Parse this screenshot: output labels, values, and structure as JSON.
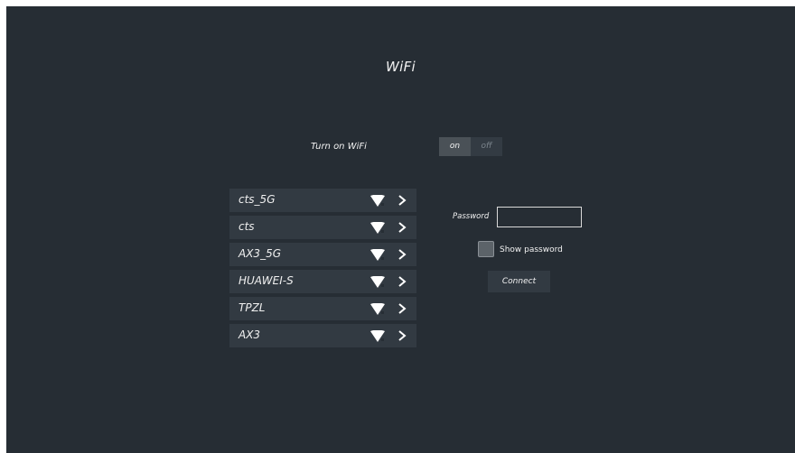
{
  "page": {
    "title": "WiFi"
  },
  "wifi_toggle": {
    "label": "Turn on WiFi",
    "on_label": "on",
    "off_label": "off",
    "state": "on"
  },
  "networks": [
    {
      "name": "cts_5G",
      "signal_icon": "wifi-signal-icon",
      "arrow_icon": "chevron-right-icon"
    },
    {
      "name": "cts",
      "signal_icon": "wifi-signal-icon",
      "arrow_icon": "chevron-right-icon"
    },
    {
      "name": "AX3_5G",
      "signal_icon": "wifi-signal-icon",
      "arrow_icon": "chevron-right-icon"
    },
    {
      "name": "HUAWEI-S",
      "signal_icon": "wifi-signal-icon",
      "arrow_icon": "chevron-right-icon"
    },
    {
      "name": "TPZL",
      "signal_icon": "wifi-signal-icon",
      "arrow_icon": "chevron-right-icon"
    },
    {
      "name": "AX3",
      "signal_icon": "wifi-signal-icon",
      "arrow_icon": "chevron-right-icon"
    }
  ],
  "password_form": {
    "password_label": "Password",
    "password_value": "",
    "show_password_label": "Show password",
    "show_password_checked": false,
    "connect_label": "Connect"
  },
  "colors": {
    "background": "#262d34",
    "item_background": "#323a42",
    "toggle_active": "#4a5157",
    "text": "#f2f2f2"
  }
}
